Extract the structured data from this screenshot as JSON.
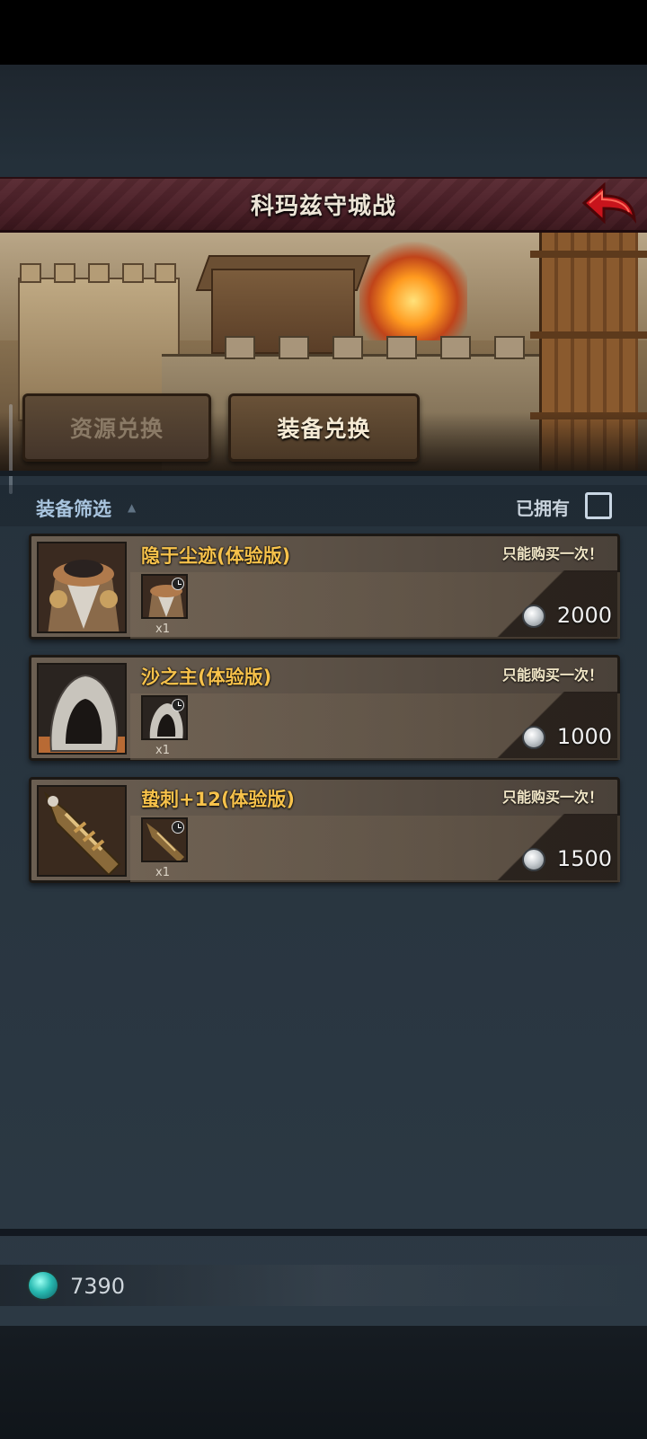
{
  "title": "科玛兹守城战",
  "tabs": {
    "resource_exchange": "资源兑换",
    "equipment_exchange": "装备兑换"
  },
  "filter": {
    "label": "装备筛选",
    "owned_label": "已拥有",
    "owned_checked": false
  },
  "items": [
    {
      "name": "隐于尘迹(体验版)",
      "limit": "只能购买一次！",
      "quantity": "x1",
      "price": "2000",
      "icon": "robed-armor-icon"
    },
    {
      "name": "沙之主(体验版)",
      "limit": "只能购买一次！",
      "quantity": "x1",
      "price": "1000",
      "icon": "white-hood-icon"
    },
    {
      "name": "蛰刺+12(体验版)",
      "limit": "只能购买一次！",
      "quantity": "x1",
      "price": "1500",
      "icon": "gauntlet-blade-icon"
    }
  ],
  "currency": {
    "amount": "7390",
    "icon": "teal-gem-icon"
  },
  "colors": {
    "title_bar": "#4a1f27",
    "item_name": "#f7c24b",
    "filter_label": "#a8c4de"
  }
}
